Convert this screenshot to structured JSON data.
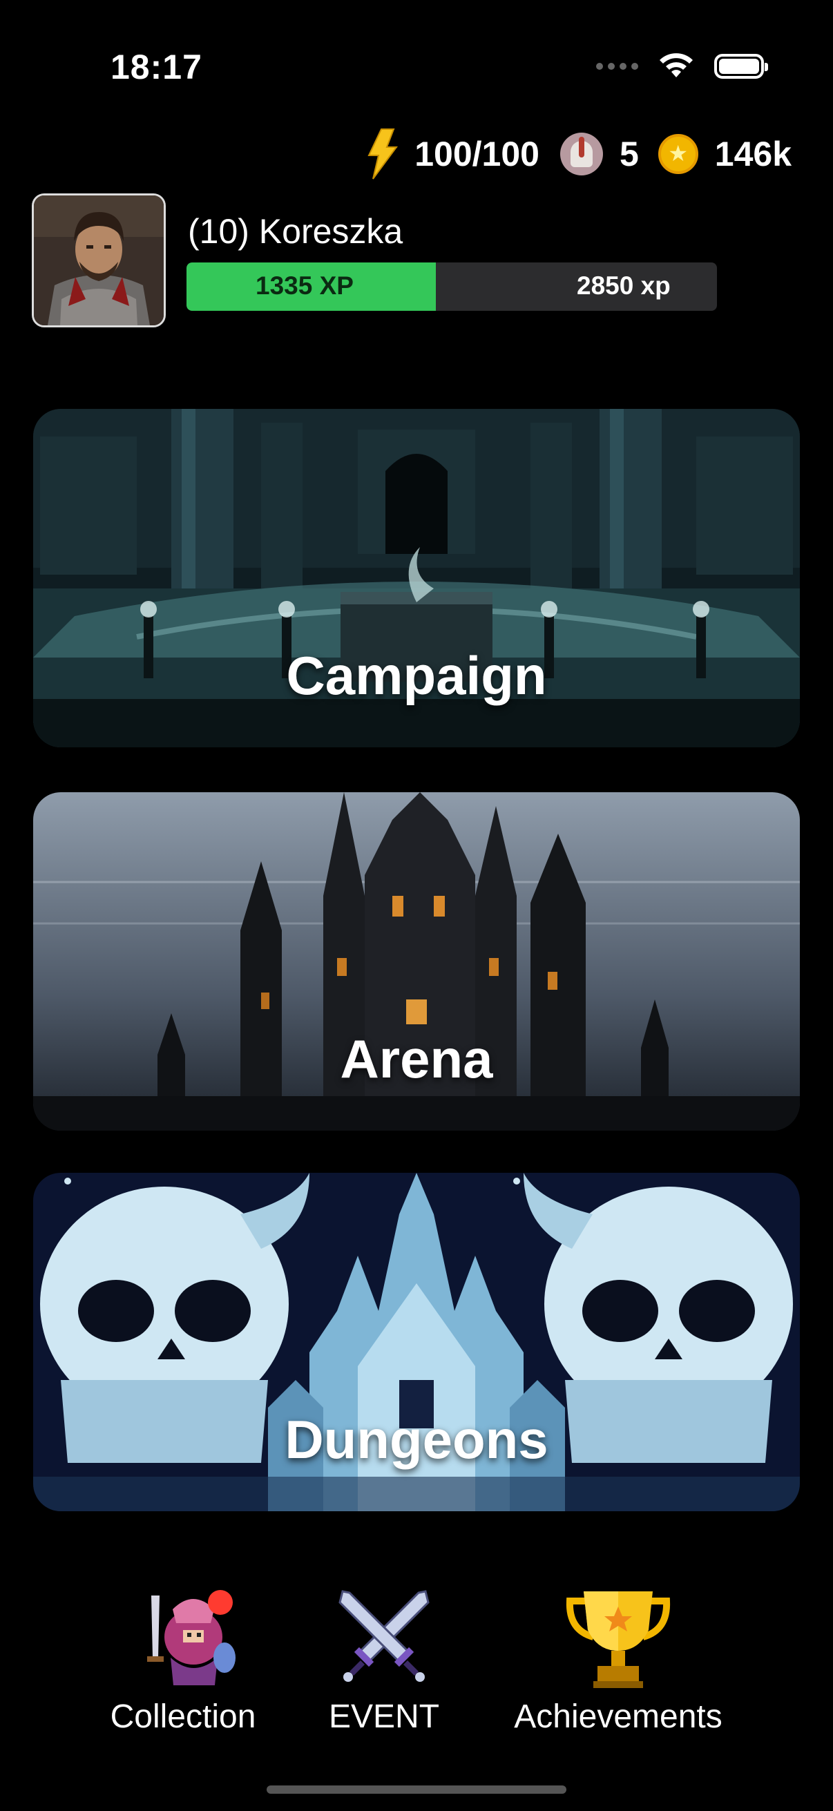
{
  "status_bar": {
    "time": "18:17"
  },
  "resources": {
    "energy": "100/100",
    "tokens": "5",
    "coins": "146k"
  },
  "player": {
    "name": "(10) Koreszka",
    "xp_current": "1335 XP",
    "xp_total": "2850 xp",
    "xp_progress": 0.47
  },
  "modes": [
    {
      "label": "Campaign"
    },
    {
      "label": "Arena"
    },
    {
      "label": "Dungeons"
    }
  ],
  "nav": [
    {
      "label": "Collection",
      "has_notification": true
    },
    {
      "label": "EVENT"
    },
    {
      "label": "Achievements"
    }
  ],
  "colors": {
    "xp_fill": "#34c759",
    "xp_track": "#2c2c2e",
    "notification": "#ff3b30"
  }
}
